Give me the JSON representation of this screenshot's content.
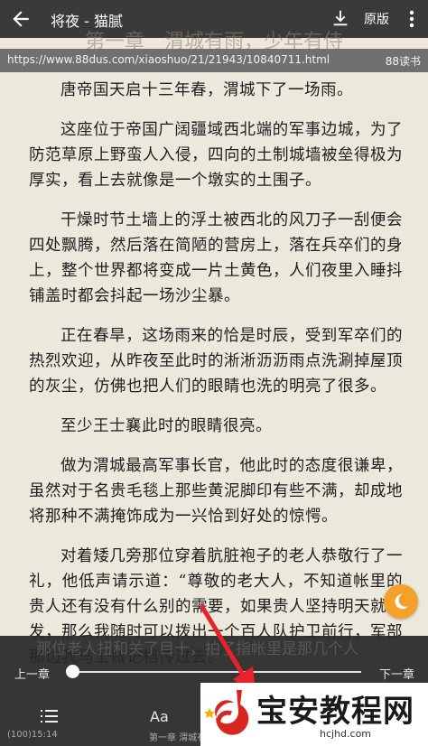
{
  "topbar": {
    "title": "将夜 - 猫腻",
    "original_label": "原版",
    "icons": [
      "back-arrow-icon",
      "download-icon",
      "more-vertical-icon"
    ]
  },
  "chapter_heading": "第一章　渭城有雨，少年有侍",
  "urlbar": {
    "url": "https://www.88dus.com/xiaoshuo/21/21943/10840711.html",
    "site": "88读书"
  },
  "paragraphs": [
    "唐帝国天启十三年春，渭城下了一场雨。",
    "这座位于帝国广阔疆域西北端的军事边城，为了防范草原上野蛮人入侵，四向的土制城墙被垒得极为厚实，看上去就像是一个墩实的土围子。",
    "干燥时节土墙上的浮土被西北的风刀子一刮便会四处飘腾，然后落在简陋的营房上，落在兵卒们的身上，整个世界都将变成一片土黄色，人们夜里入睡抖铺盖时都会抖起一场沙尘暴。",
    "正在春旱，这场雨来的恰是时辰，受到军卒们的热烈欢迎，从昨夜至此时的淅淅沥沥雨点洗涮掉屋顶的灰尘，仿佛也把人们的眼睛也洗的明亮了很多。",
    "至少王士襄此时的眼睛很亮。",
    "做为渭城最高军事长官，他此时的态度很谦卑，虽然对于名贵毛毯上那些黄泥脚印有些不满，却成地将那种不满掩饰成为一兴恰到好处的惊愕。",
    "对着矮几旁那位穿着肮脏袍子的老人恭敬行了一礼，他低声请示道：“尊敬的老大人，不知道帐里的贵人还有没有什么别的需要，如果贵人坚持明天就出发，那么我随时可以拨出一个百人队护卫前行，军部那边我马上做记档传过去。”"
  ],
  "bottom_panel": {
    "ghost_text": "那位老人扭和关了目十，拍了指帐里是那几个人",
    "prev_chapter": "上一章",
    "next_chapter": "下一章",
    "progress_fraction": 0.0,
    "font_label": "Aa",
    "status_left": "(100)15:14",
    "status_mid": "第一章 渭城有雨..."
  },
  "watermark": {
    "name": "宝安教程网",
    "url": "hcjhd.com"
  },
  "colors": {
    "page_bg": "#ece8dc",
    "topbar_bg": "#3a3a3a",
    "night_button": "#f5a028",
    "arrow": "#e8222a",
    "logo_red": "#d8261f"
  }
}
